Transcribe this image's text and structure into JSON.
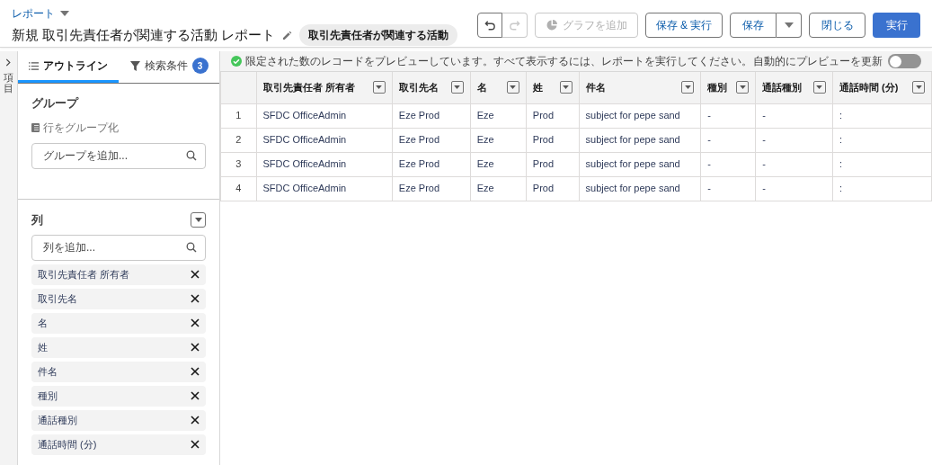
{
  "breadcrumb": "レポート",
  "title": "新規 取引先責任者が関連する活動 レポート",
  "report_type": "取引先責任者が関連する活動",
  "toolbar": {
    "undo_disabled": false,
    "redo_disabled": true,
    "add_chart": {
      "label": "グラフを追加",
      "disabled": true
    },
    "save_run": "保存 & 実行",
    "save": "保存",
    "close": "閉じる",
    "run": "実行"
  },
  "side_rail": {
    "label": "項目"
  },
  "tabs": [
    {
      "label": "アウトライン",
      "selected": true
    },
    {
      "label": "検索条件",
      "selected": false,
      "count": "3"
    }
  ],
  "groups": {
    "heading": "グループ",
    "subheading": "行をグループ化",
    "placeholder": "グループを追加..."
  },
  "columns_panel": {
    "heading": "列",
    "placeholder": "列を追加...",
    "items": [
      "取引先責任者 所有者",
      "取引先名",
      "名",
      "姓",
      "件名",
      "種別",
      "通話種別",
      "通話時間 (分)"
    ]
  },
  "preview": {
    "message": "限定された数のレコードをプレビューしています。すべて表示するには、レポートを実行してください。",
    "auto_update_label": "自動的にプレビューを更新",
    "auto_update_on": false
  },
  "table": {
    "columns": [
      "取引先責任者 所有者",
      "取引先名",
      "名",
      "姓",
      "件名",
      "種別",
      "通話種別",
      "通話時間 (分)"
    ],
    "rows": [
      {
        "number": "1",
        "cells": [
          "SFDC OfficeAdmin",
          "Eze Prod",
          "Eze",
          "Prod",
          "subject for pepe sand",
          "-",
          "-",
          ":"
        ]
      },
      {
        "number": "2",
        "cells": [
          "SFDC OfficeAdmin",
          "Eze Prod",
          "Eze",
          "Prod",
          "subject for pepe sand",
          "-",
          "-",
          ":"
        ]
      },
      {
        "number": "3",
        "cells": [
          "SFDC OfficeAdmin",
          "Eze Prod",
          "Eze",
          "Prod",
          "subject for pepe sand",
          "-",
          "-",
          ":"
        ]
      },
      {
        "number": "4",
        "cells": [
          "SFDC OfficeAdmin",
          "Eze Prod",
          "Eze",
          "Prod",
          "subject for pepe sand",
          "-",
          "-",
          ":"
        ]
      }
    ]
  }
}
